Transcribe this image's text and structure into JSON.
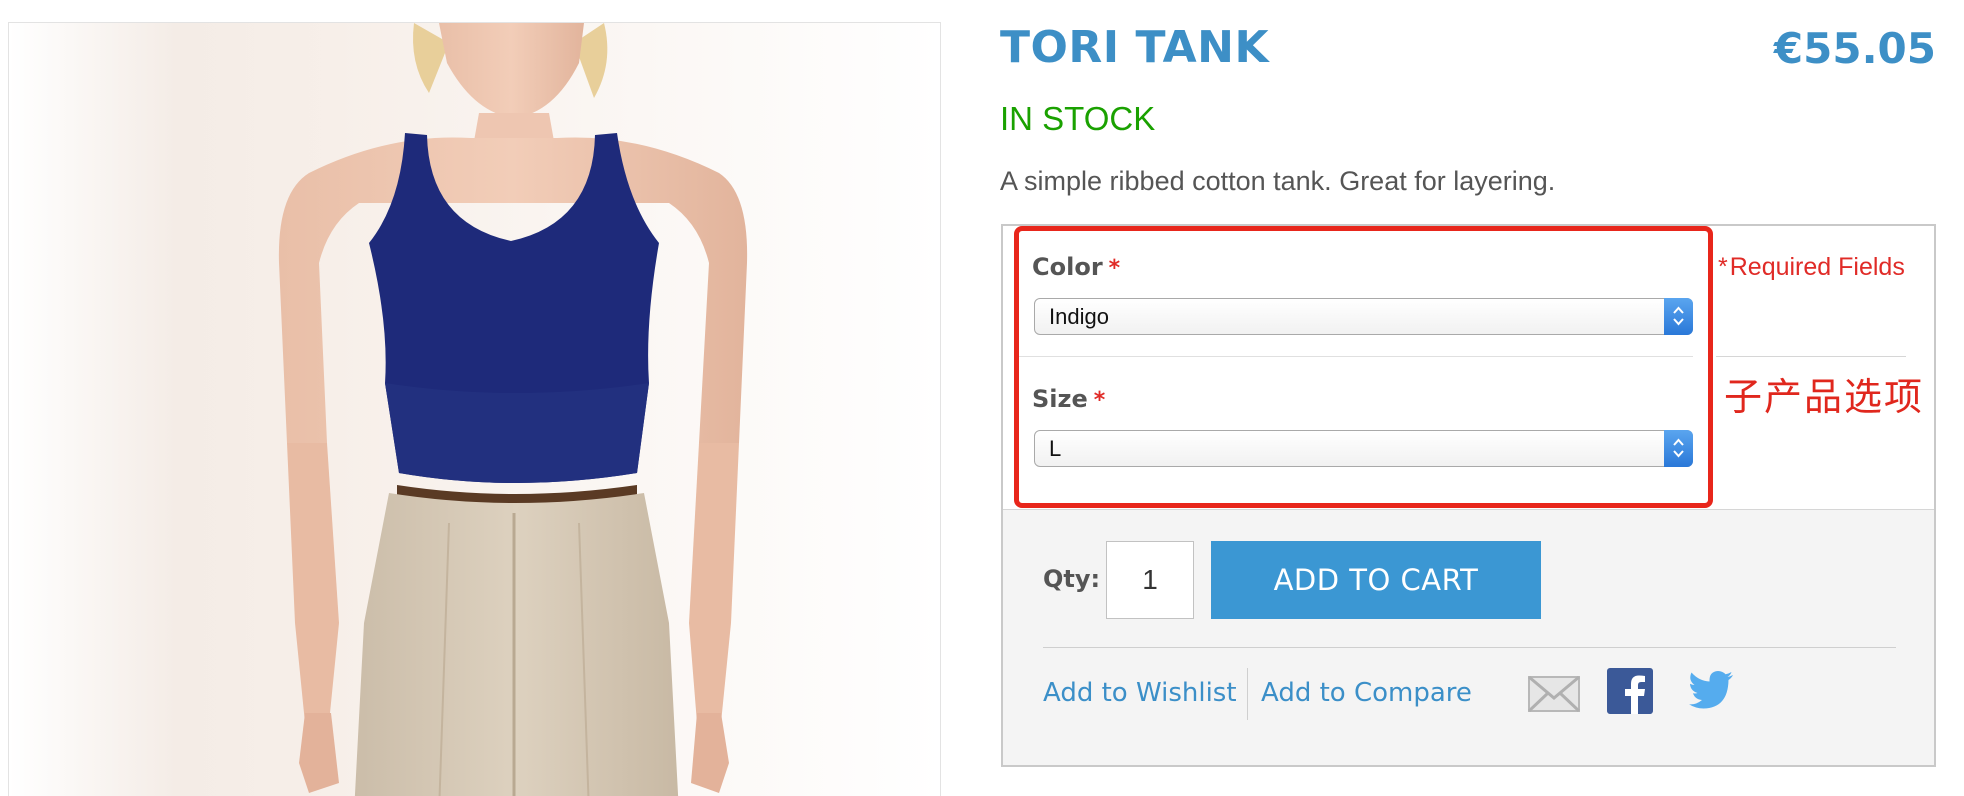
{
  "product": {
    "title": "TORI TANK",
    "price": "€55.05",
    "stock_status": "IN STOCK",
    "description": "A simple ribbed cotton tank. Great for layering."
  },
  "options": {
    "required_note": "Required Fields",
    "required_marker": "*",
    "color": {
      "label": "Color",
      "selected": "Indigo"
    },
    "size": {
      "label": "Size",
      "selected": "L"
    }
  },
  "annotation": {
    "text": "子产品选项",
    "color": "#e0271d"
  },
  "cart": {
    "qty_label": "Qty:",
    "qty_value": "1",
    "add_to_cart_label": "ADD TO CART"
  },
  "actions": {
    "wishlist_label": "Add to Wishlist",
    "compare_label": "Add to Compare",
    "share_icons": [
      "email-icon",
      "facebook-icon",
      "twitter-icon"
    ]
  },
  "colors": {
    "accent": "#3b97d3",
    "in_stock": "#1aa100",
    "required": "#e02b27",
    "tank_top": "#1e2a7a"
  }
}
